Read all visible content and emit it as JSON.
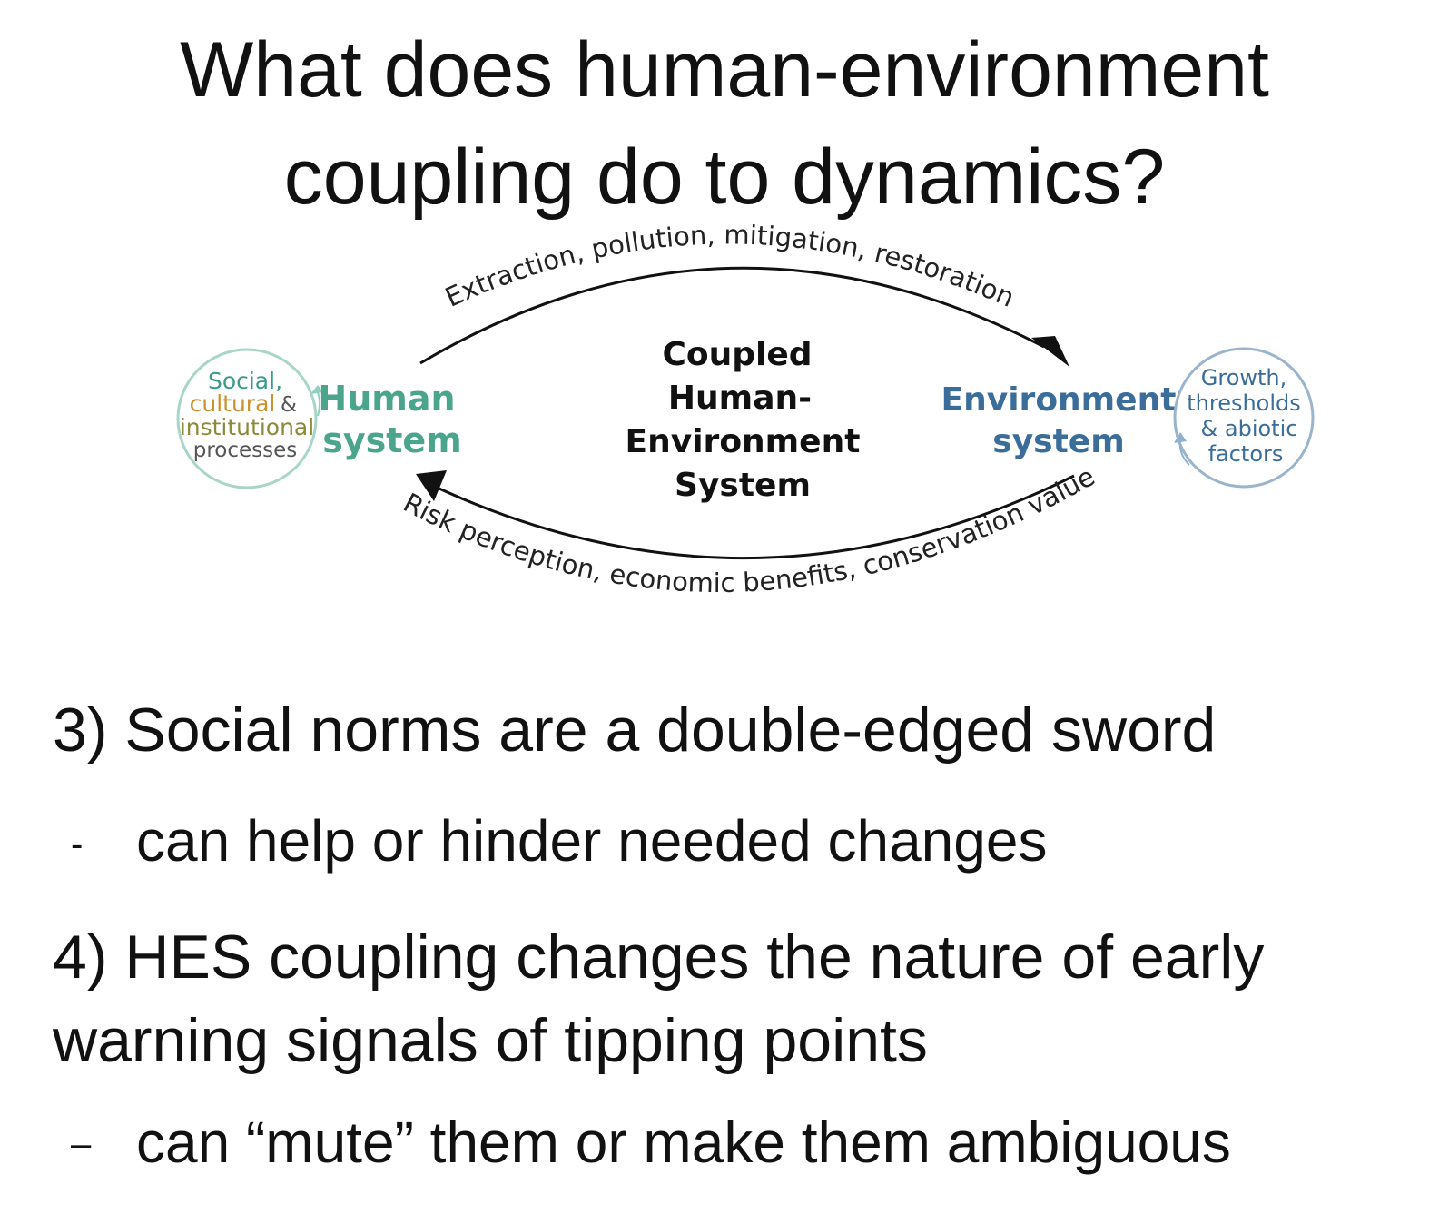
{
  "title": {
    "line1": "What does human-environment",
    "line2": "coupling do to dynamics?"
  },
  "diagram": {
    "top_arrow_label": "Extraction, pollution, mitigation, restoration",
    "bottom_arrow_label": "Risk perception, economic benefits, conservation value",
    "center_label": [
      "Coupled",
      "Human-",
      "Environment",
      "System"
    ],
    "human_system": [
      "Human",
      "system"
    ],
    "environment_system": [
      "Environment",
      "system"
    ],
    "left_circle": {
      "social": "Social,",
      "cultural": "cultural",
      "amp": "&",
      "institutional": "institutional",
      "processes": "processes"
    },
    "right_circle": [
      "Growth,",
      "thresholds",
      "& abiotic",
      "factors"
    ],
    "colors": {
      "human": "#4aa58c",
      "environment": "#3a6d99",
      "social": "#3b9a8a",
      "cultural": "#c9922e",
      "institutional": "#8c8a3a",
      "processes": "#555555",
      "left_circle_stroke": "#a9d5c8",
      "right_circle_stroke": "#9ab4cc",
      "arrow": "#111111"
    }
  },
  "bullets": {
    "item3": "3) Social norms are a double-edged sword",
    "item3_sub": "can help or hinder needed changes",
    "item3_dash": "-",
    "item4_line1": "4) HES coupling changes the nature of early",
    "item4_line2": "warning signals of tipping points",
    "item4_sub": "can “mute” them or make them ambiguous",
    "item4_dash": "–"
  }
}
